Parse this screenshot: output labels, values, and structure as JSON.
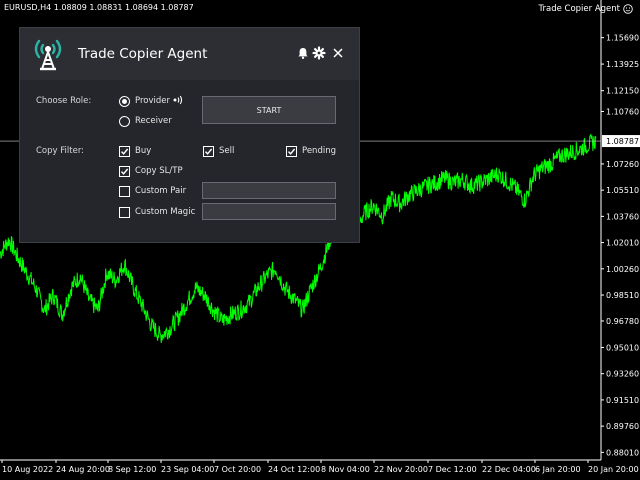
{
  "chart": {
    "symbol_info": "EURUSD,H4  1.08809 1.08831 1.08694 1.08787",
    "ea_name": "Trade Copier Agent",
    "current_price": "1.08787",
    "price_labels": [
      "1.15690",
      "1.13925",
      "1.12150",
      "1.10760",
      "1.08787",
      "1.07260",
      "1.05510",
      "1.03760",
      "1.02010",
      "1.00260",
      "0.98510",
      "0.96780",
      "0.95010",
      "0.93260",
      "0.91510",
      "0.89760",
      "0.88010"
    ],
    "date_labels": [
      "10 Aug 2022",
      "24 Aug 20:00",
      "8 Sep 12:00",
      "23 Sep 04:00",
      "7 Oct 20:00",
      "24 Oct 12:00",
      "8 Nov 04:00",
      "22 Nov 20:00",
      "7 Dec 12:00",
      "22 Dec 04:00",
      "6 Jan 20:00",
      "20 Jan 20:00"
    ],
    "price_series": [
      1.013,
      1.022,
      1.01,
      1.0,
      0.99,
      0.975,
      0.985,
      0.972,
      0.99,
      0.998,
      0.982,
      0.975,
      1.0,
      0.995,
      1.006,
      0.99,
      0.978,
      0.965,
      0.958,
      0.962,
      0.97,
      0.98,
      0.99,
      0.985,
      0.975,
      0.968,
      0.972,
      0.975,
      0.98,
      0.99,
      0.998,
      1.003,
      0.99,
      0.983,
      0.975,
      0.99,
      1.003,
      1.02,
      1.04,
      1.038,
      1.03,
      1.04,
      1.045,
      1.038,
      1.05,
      1.046,
      1.052,
      1.055,
      1.058,
      1.06,
      1.063,
      1.06,
      1.062,
      1.058,
      1.06,
      1.063,
      1.066,
      1.061,
      1.056,
      1.048,
      1.065,
      1.07,
      1.073,
      1.078,
      1.08,
      1.082,
      1.085,
      1.088
    ],
    "line_color": "#00ff00",
    "price_range": [
      0.875,
      1.17
    ]
  },
  "panel": {
    "title": "Trade Copier Agent",
    "choose_role_label": "Choose Role:",
    "role_provider": "Provider",
    "role_receiver": "Receiver",
    "selected_role": "Provider",
    "start_label": "START",
    "copy_filter_label": "Copy Filter:",
    "filter_buy": "Buy",
    "filter_sell": "Sell",
    "filter_pending": "Pending",
    "filter_sltp": "Copy SL/TP",
    "filter_custom_pair": "Custom Pair",
    "filter_custom_magic": "Custom Magic",
    "custom_pair_value": "",
    "custom_magic_value": "",
    "accent_color": "#2bb5a6"
  }
}
